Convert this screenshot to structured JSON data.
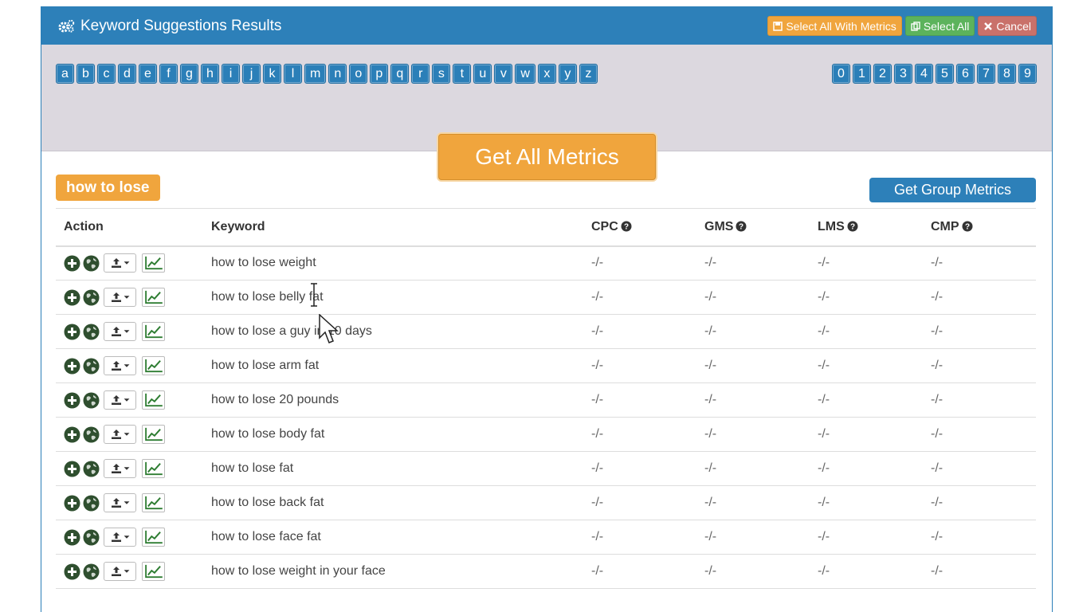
{
  "header": {
    "title": "Keyword Suggestions Results",
    "buttons": {
      "select_all_with_metrics": "Select All With Metrics",
      "select_all": "Select All",
      "cancel": "Cancel"
    }
  },
  "letters": [
    "a",
    "b",
    "c",
    "d",
    "e",
    "f",
    "g",
    "h",
    "i",
    "j",
    "k",
    "l",
    "m",
    "n",
    "o",
    "p",
    "q",
    "r",
    "s",
    "t",
    "u",
    "v",
    "w",
    "x",
    "y",
    "z"
  ],
  "digits": [
    "0",
    "1",
    "2",
    "3",
    "4",
    "5",
    "6",
    "7",
    "8",
    "9"
  ],
  "get_all_metrics": "Get All Metrics",
  "group": {
    "tag": "how to lose",
    "get_group_metrics": "Get Group Metrics"
  },
  "table": {
    "headers": {
      "action": "Action",
      "keyword": "Keyword",
      "cpc": "CPC",
      "gms": "GMS",
      "lms": "LMS",
      "cmp": "CMP"
    },
    "rows": [
      {
        "keyword": "how to lose weight",
        "cpc": "-/-",
        "gms": "-/-",
        "lms": "-/-",
        "cmp": "-/-"
      },
      {
        "keyword": "how to lose belly fat",
        "cpc": "-/-",
        "gms": "-/-",
        "lms": "-/-",
        "cmp": "-/-"
      },
      {
        "keyword": "how to lose a guy in 10 days",
        "cpc": "-/-",
        "gms": "-/-",
        "lms": "-/-",
        "cmp": "-/-"
      },
      {
        "keyword": "how to lose arm fat",
        "cpc": "-/-",
        "gms": "-/-",
        "lms": "-/-",
        "cmp": "-/-"
      },
      {
        "keyword": "how to lose 20 pounds",
        "cpc": "-/-",
        "gms": "-/-",
        "lms": "-/-",
        "cmp": "-/-"
      },
      {
        "keyword": "how to lose body fat",
        "cpc": "-/-",
        "gms": "-/-",
        "lms": "-/-",
        "cmp": "-/-"
      },
      {
        "keyword": "how to lose fat",
        "cpc": "-/-",
        "gms": "-/-",
        "lms": "-/-",
        "cmp": "-/-"
      },
      {
        "keyword": "how to lose back fat",
        "cpc": "-/-",
        "gms": "-/-",
        "lms": "-/-",
        "cmp": "-/-"
      },
      {
        "keyword": "how to lose face fat",
        "cpc": "-/-",
        "gms": "-/-",
        "lms": "-/-",
        "cmp": "-/-"
      },
      {
        "keyword": "how to lose weight in your face",
        "cpc": "-/-",
        "gms": "-/-",
        "lms": "-/-",
        "cmp": "-/-"
      }
    ]
  },
  "colors": {
    "primary": "#2d80b9",
    "orange": "#f0a53d",
    "green": "#5cb35c",
    "red": "#c9716a",
    "action_icon": "#2f4f2f"
  },
  "icons": {
    "title": "gears-icon",
    "row_actions": [
      "add-circle-icon",
      "globe-icon",
      "upload-dropdown-icon",
      "line-chart-icon"
    ],
    "header_help": "question-circle-icon"
  }
}
